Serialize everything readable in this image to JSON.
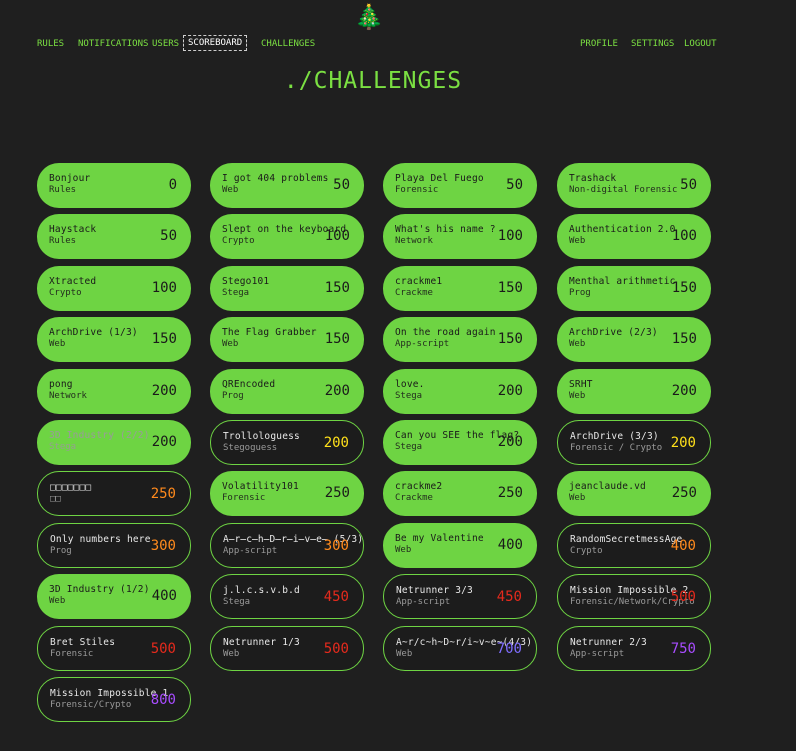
{
  "nav": {
    "left": [
      "RULES",
      "NOTIFICATIONS",
      "USERS",
      "SCOREBOARD",
      "CHALLENGES"
    ],
    "right": [
      "PROFILE",
      "SETTINGS",
      "LOGOUT"
    ],
    "active": "SCOREBOARD"
  },
  "logo_icon": "christmas-tree-icon",
  "page_title": "./CHALLENGES",
  "colors": {
    "bg": "#1f1f1f",
    "solved": "#6ed443",
    "pts_yellow": "#ffe01a",
    "pts_orange": "#ff8a1c",
    "pts_red": "#e52a1c",
    "pts_purple": "#a84cff",
    "pts_blue": "#7f6dff"
  },
  "columns": [
    [
      {
        "name": "Bonjour",
        "category": "Rules",
        "points": "0",
        "state": "solved"
      },
      {
        "name": "Haystack",
        "category": "Rules",
        "points": "50",
        "state": "solved"
      },
      {
        "name": "Xtracted",
        "category": "Crypto",
        "points": "100",
        "state": "solved"
      },
      {
        "name": "ArchDrive (1/3)",
        "category": "Web",
        "points": "150",
        "state": "solved"
      },
      {
        "name": "pong",
        "category": "Network",
        "points": "200",
        "state": "solved"
      },
      {
        "name": "3D Industry (2/2)",
        "category": "Stega",
        "points": "200",
        "state": "solved-dim"
      },
      {
        "name": "□□□□□□□",
        "category": "□□",
        "points": "250",
        "state": "open",
        "color": "#ff8a1c"
      },
      {
        "name": "Only numbers here",
        "category": "Prog",
        "points": "300",
        "state": "open",
        "color": "#ff8a1c"
      },
      {
        "name": "3D Industry (1/2)",
        "category": "Web",
        "points": "400",
        "state": "solved"
      },
      {
        "name": "Bret Stiles",
        "category": "Forensic",
        "points": "500",
        "state": "open",
        "color": "#e52a1c"
      },
      {
        "name": "Mission Impossible 1",
        "category": "Forensic/Crypto",
        "points": "800",
        "state": "open",
        "color": "#a84cff"
      }
    ],
    [
      {
        "name": "I got 404 problems",
        "category": "Web",
        "points": "50",
        "state": "solved"
      },
      {
        "name": "Slept on the keyboard",
        "category": "Crypto",
        "points": "100",
        "state": "solved"
      },
      {
        "name": "Stego101",
        "category": "Stega",
        "points": "150",
        "state": "solved"
      },
      {
        "name": "The Flag Grabber",
        "category": "Web",
        "points": "150",
        "state": "solved"
      },
      {
        "name": "QREncoded",
        "category": "Prog",
        "points": "200",
        "state": "solved"
      },
      {
        "name": "Trollologuess",
        "category": "Stegoguess",
        "points": "200",
        "state": "open",
        "color": "#ffe01a"
      },
      {
        "name": "Volatility101",
        "category": "Forensic",
        "points": "250",
        "state": "solved"
      },
      {
        "name": "A̶r̶c̶h̶D̶r̶i̶v̶e̶ (5/3)",
        "category": "App-script",
        "points": "300",
        "state": "open",
        "color": "#ff8a1c"
      },
      {
        "name": "j.l.c.s.v.b.d",
        "category": "Stega",
        "points": "450",
        "state": "open",
        "color": "#e52a1c"
      },
      {
        "name": "Netrunner 1/3",
        "category": "Web",
        "points": "500",
        "state": "open",
        "color": "#e52a1c"
      }
    ],
    [
      {
        "name": "Playa Del Fuego",
        "category": "Forensic",
        "points": "50",
        "state": "solved"
      },
      {
        "name": "What's his name ?",
        "category": "Network",
        "points": "100",
        "state": "solved"
      },
      {
        "name": "crackme1",
        "category": "Crackme",
        "points": "150",
        "state": "solved"
      },
      {
        "name": "On the road again",
        "category": "App-script",
        "points": "150",
        "state": "solved"
      },
      {
        "name": "love.",
        "category": "Stega",
        "points": "200",
        "state": "solved"
      },
      {
        "name": "Can you SEE the flag?",
        "category": "Stega",
        "points": "200",
        "state": "solved"
      },
      {
        "name": "crackme2",
        "category": "Crackme",
        "points": "250",
        "state": "solved"
      },
      {
        "name": "Be my Valentine",
        "category": "Web",
        "points": "400",
        "state": "solved"
      },
      {
        "name": "Netrunner 3/3",
        "category": "App-script",
        "points": "450",
        "state": "open",
        "color": "#e52a1c"
      },
      {
        "name": "A~r/c~h~D~r/i~v~e~(4/3)",
        "category": "Web",
        "points": "700",
        "state": "open",
        "color": "#7f6dff"
      }
    ],
    [
      {
        "name": "Trashack",
        "category": "Non-digital Forensic",
        "points": "50",
        "state": "solved"
      },
      {
        "name": "Authentication 2.0",
        "category": "Web",
        "points": "100",
        "state": "solved"
      },
      {
        "name": "Menthal arithmetic",
        "category": "Prog",
        "points": "150",
        "state": "solved"
      },
      {
        "name": "ArchDrive (2/3)",
        "category": "Web",
        "points": "150",
        "state": "solved"
      },
      {
        "name": "SRHT",
        "category": "Web",
        "points": "200",
        "state": "solved"
      },
      {
        "name": "ArchDrive (3/3)",
        "category": "Forensic / Crypto",
        "points": "200",
        "state": "open",
        "color": "#ffe01a"
      },
      {
        "name": "jeanclaude.vd",
        "category": "Web",
        "points": "250",
        "state": "solved"
      },
      {
        "name": "RandomSecretmessAge",
        "category": "Crypto",
        "points": "400",
        "state": "open",
        "color": "#ff8a1c"
      },
      {
        "name": "Mission Impossible 2",
        "category": "Forensic/Network/Crypto",
        "points": "500",
        "state": "open",
        "color": "#e52a1c"
      },
      {
        "name": "Netrunner 2/3",
        "category": "App-script",
        "points": "750",
        "state": "open",
        "color": "#a84cff"
      }
    ]
  ]
}
